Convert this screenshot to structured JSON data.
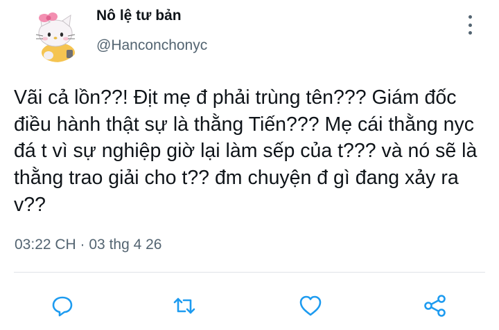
{
  "tweet": {
    "display_name": "Nô lệ tư bản",
    "handle": "@Hanconchonyc",
    "text": "Vãi cả lồn??! Địt mẹ đ phải trùng tên??? Giám đốc điều hành thật sự là thằng Tiến??? Mẹ cái thằng nyc đá t vì sự nghiệp giờ lại làm sếp của t??? và nó sẽ là thằng trao giải cho t?? đm chuyện đ gì đang xảy ra v??",
    "timestamp": "03:22 CH · 03 thg 4 26"
  },
  "icons": {
    "more": "more-vertical-icon",
    "reply": "reply-icon",
    "retweet": "retweet-icon",
    "like": "heart-icon",
    "share": "share-icon"
  },
  "colors": {
    "icon": "#1d9bf0",
    "secondary_text": "#536471",
    "primary_text": "#0f1419",
    "divider": "#dfe3e7"
  }
}
